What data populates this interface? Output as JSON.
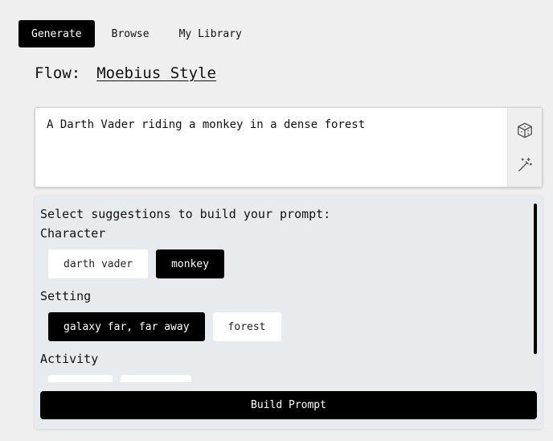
{
  "nav": {
    "tabs": [
      {
        "label": "Generate",
        "active": true
      },
      {
        "label": "Browse",
        "active": false
      },
      {
        "label": "My Library",
        "active": false
      }
    ]
  },
  "flow": {
    "label": "Flow:",
    "name": "Moebius Style"
  },
  "prompt": {
    "value": "A Darth Vader riding a monkey in a dense forest",
    "tools": [
      "cube-icon",
      "magic-wand-icon"
    ]
  },
  "suggestions": {
    "title": "Select suggestions to build your prompt:",
    "categories": [
      {
        "label": "Character",
        "chips": [
          {
            "label": "darth vader",
            "selected": false
          },
          {
            "label": "monkey",
            "selected": true
          }
        ]
      },
      {
        "label": "Setting",
        "chips": [
          {
            "label": "galaxy far, far away",
            "selected": true
          },
          {
            "label": "forest",
            "selected": false
          }
        ]
      },
      {
        "label": "Activity",
        "chips": []
      }
    ],
    "build_button": "Build Prompt"
  },
  "colors": {
    "accent": "#000000",
    "page_bg": "#efefef",
    "panel_bg": "#e8ebee"
  }
}
